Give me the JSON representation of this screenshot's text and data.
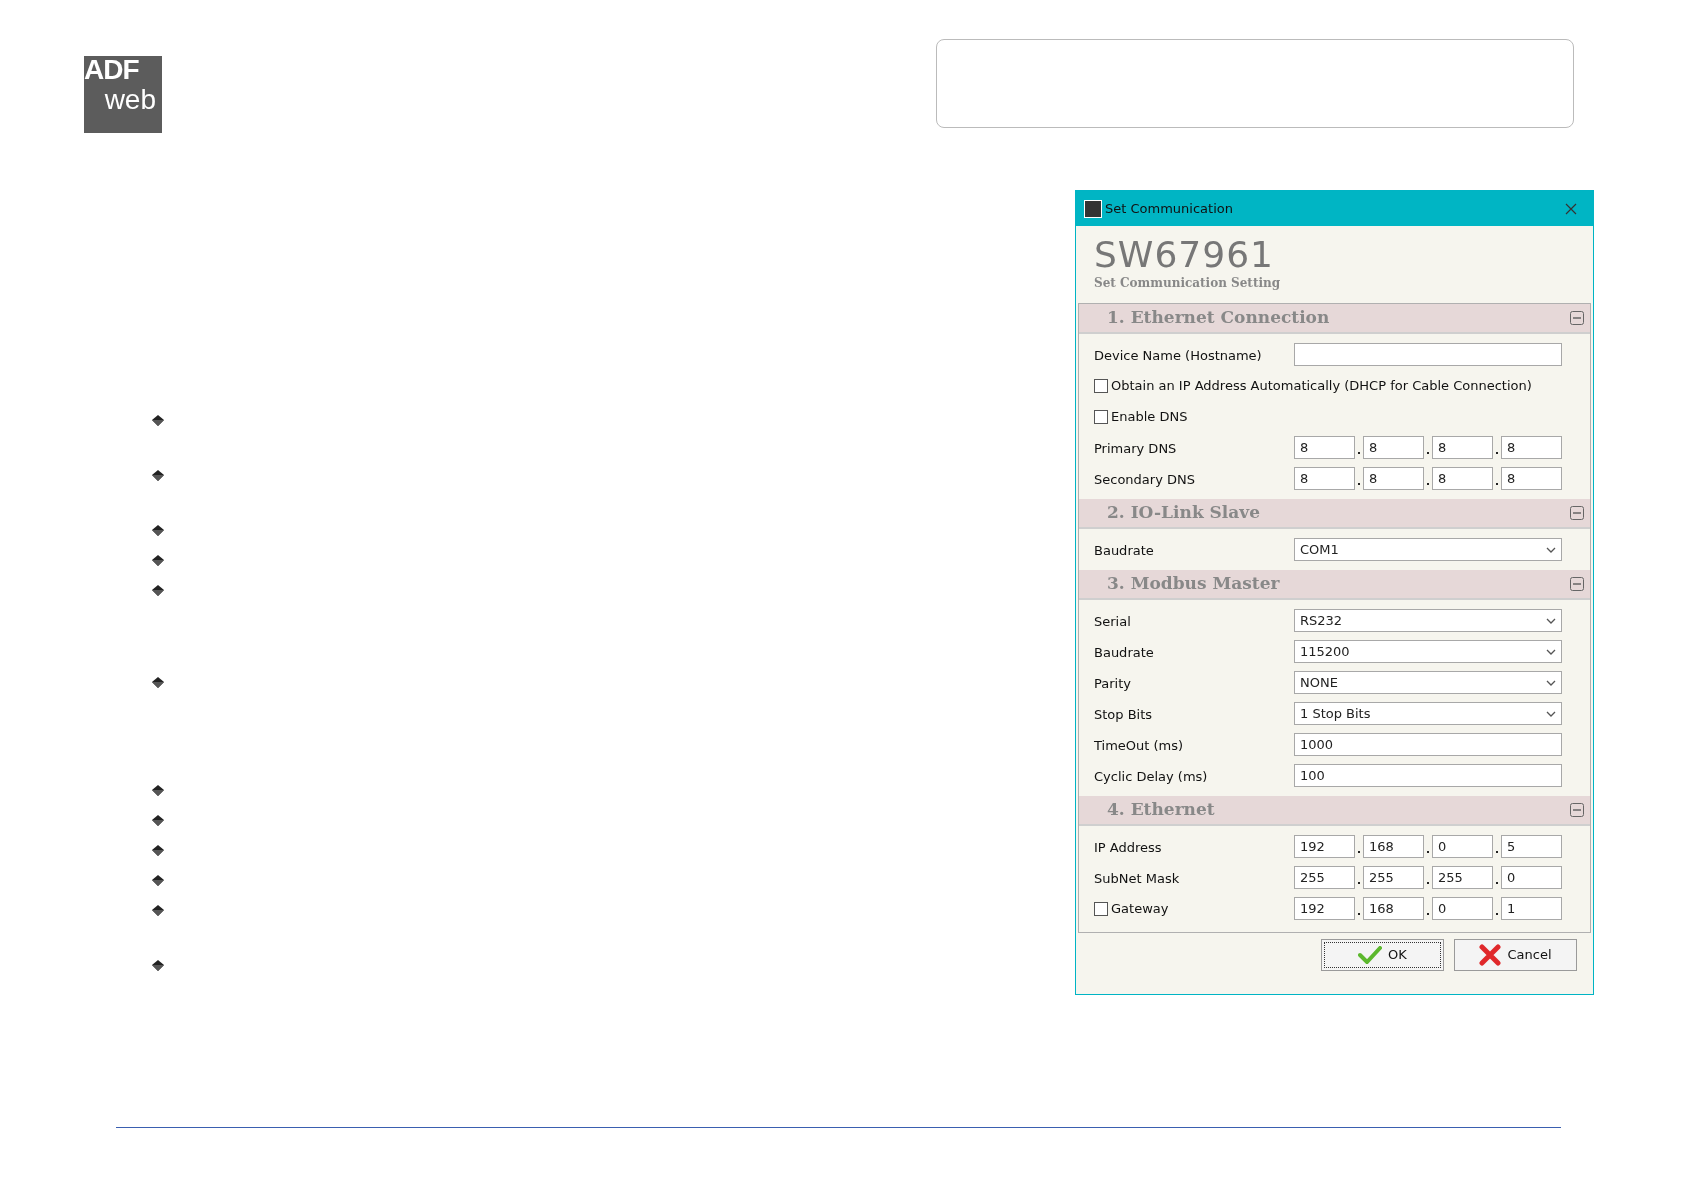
{
  "logo": {
    "line1": "ADF",
    "line2": "web"
  },
  "window": {
    "title": "Set Communication"
  },
  "header": {
    "code": "SW67961",
    "subtitle": "Set Communication Setting"
  },
  "sections": [
    {
      "title": "1. Ethernet Connection",
      "rows": [
        {
          "kind": "text",
          "label": "Device Name (Hostname)"
        },
        {
          "kind": "check",
          "label": "Obtain an IP Address Automatically (DHCP for Cable Connection)",
          "checked": false
        },
        {
          "kind": "check",
          "label": "Enable DNS",
          "checked": false
        },
        {
          "kind": "ip",
          "label": "Primary DNS",
          "octets": [
            "8",
            "8",
            "8",
            "8"
          ]
        },
        {
          "kind": "ip",
          "label": "Secondary DNS",
          "octets": [
            "8",
            "8",
            "8",
            "8"
          ]
        }
      ]
    },
    {
      "title": "2. IO-Link Slave",
      "rows": [
        {
          "kind": "select",
          "label": "Baudrate",
          "value": "COM1"
        }
      ]
    },
    {
      "title": "3. Modbus Master",
      "rows": [
        {
          "kind": "select",
          "label": "Serial",
          "value": "RS232"
        },
        {
          "kind": "select",
          "label": "Baudrate",
          "value": "115200"
        },
        {
          "kind": "select",
          "label": "Parity",
          "value": "NONE"
        },
        {
          "kind": "select",
          "label": "Stop Bits",
          "value": "1 Stop Bits"
        },
        {
          "kind": "text",
          "label": "TimeOut (ms)",
          "value": "1000"
        },
        {
          "kind": "text",
          "label": "Cyclic Delay (ms)",
          "value": "100"
        }
      ]
    },
    {
      "title": "4. Ethernet",
      "rows": [
        {
          "kind": "ip",
          "label": "IP Address",
          "octets": [
            "192",
            "168",
            "0",
            "5"
          ]
        },
        {
          "kind": "ip",
          "label": "SubNet Mask",
          "octets": [
            "255",
            "255",
            "255",
            "0"
          ]
        },
        {
          "kind": "checkip",
          "label": "Gateway",
          "checked": false,
          "octets": [
            "192",
            "168",
            "0",
            "1"
          ]
        }
      ]
    }
  ],
  "buttons": [
    {
      "kind": "ok",
      "label": "OK"
    },
    {
      "kind": "cancel",
      "label": "Cancel"
    }
  ]
}
